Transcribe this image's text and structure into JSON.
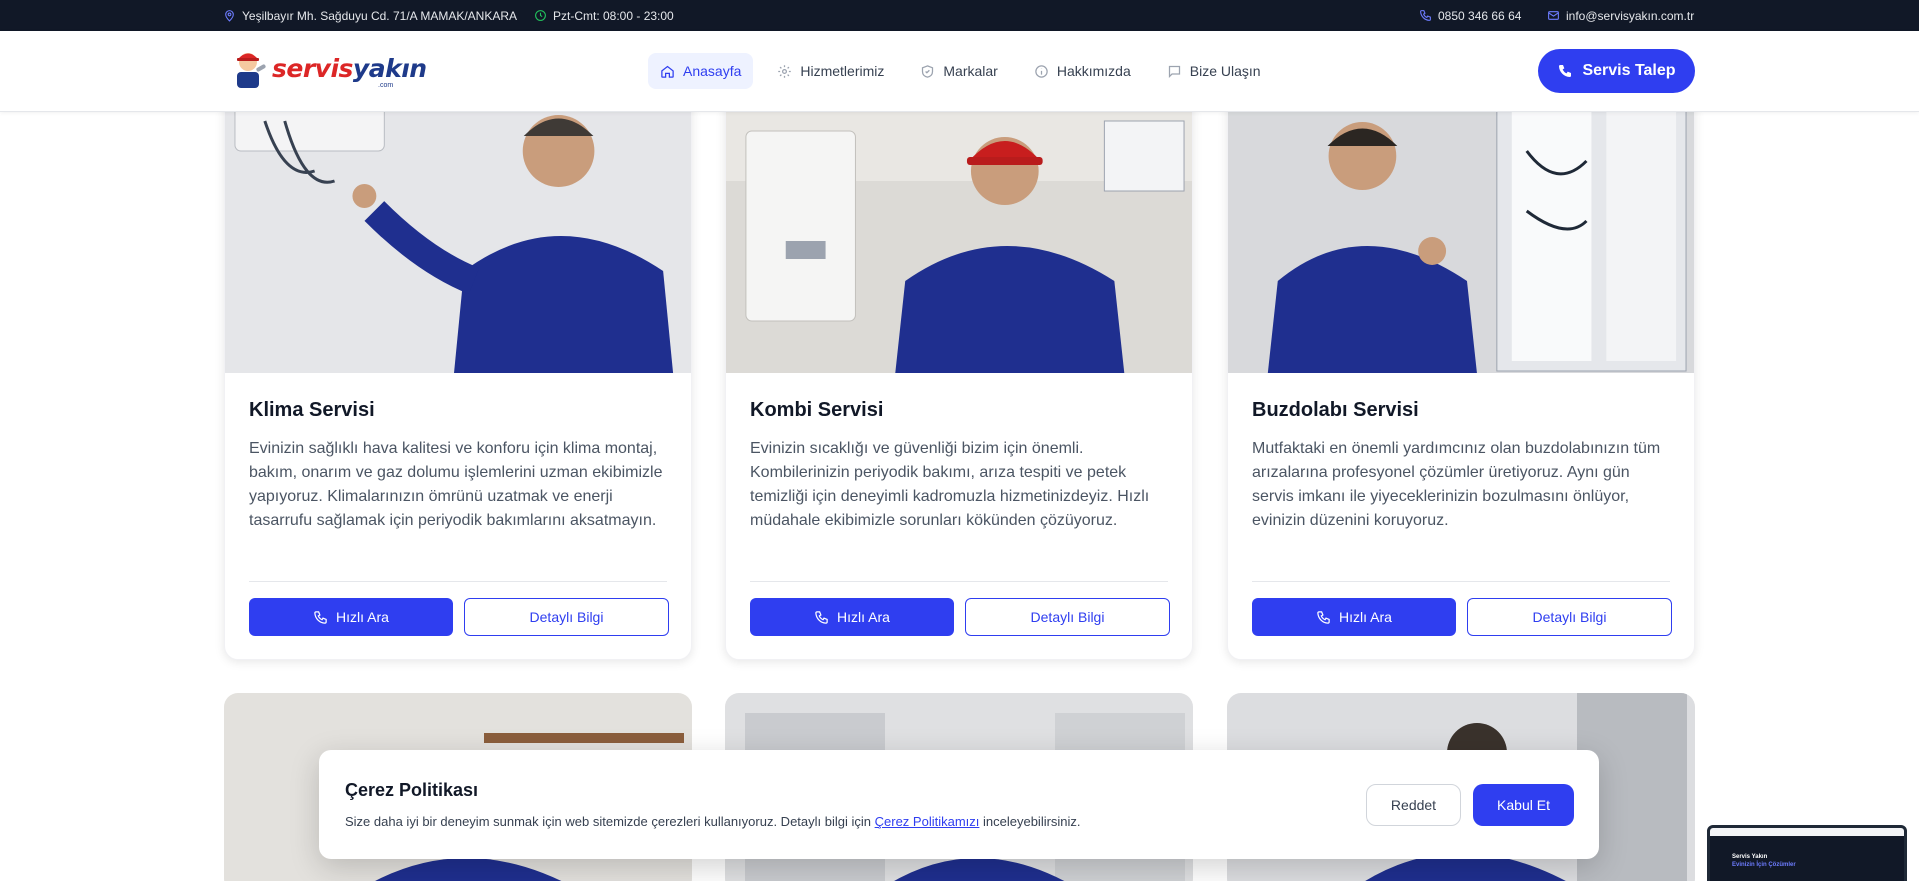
{
  "topbar": {
    "address": "Yeşilbayır Mh. Sağduyu Cd. 71/A MAMAK/ANKARA",
    "hours": "Pzt-Cmt: 08:00 - 23:00",
    "phone": "0850 346 66 64",
    "email": "info@servisyakın.com.tr"
  },
  "header": {
    "logo": {
      "part1": "servis",
      "part2": "yakın",
      "tld": ".com"
    },
    "nav": [
      {
        "label": "Anasayfa",
        "icon": "home-icon",
        "active": true
      },
      {
        "label": "Hizmetlerimiz",
        "icon": "gear-icon",
        "active": false
      },
      {
        "label": "Markalar",
        "icon": "shield-icon",
        "active": false
      },
      {
        "label": "Hakkımızda",
        "icon": "info-icon",
        "active": false
      },
      {
        "label": "Bize Ulaşın",
        "icon": "chat-icon",
        "active": false
      }
    ],
    "cta_label": "Servis Talep"
  },
  "services": [
    {
      "title": "Klima Servisi",
      "description": "Evinizin sağlıklı hava kalitesi ve konforu için klima montaj, bakım, onarım ve gaz dolumu işlemlerini uzman ekibimizle yapıyoruz. Klimalarınızın ömrünü uzatmak ve enerji tasarrufu sağlamak için periyodik bakımlarını aksatmayın.",
      "call_label": "Hızlı Ara",
      "info_label": "Detaylı Bilgi"
    },
    {
      "title": "Kombi Servisi",
      "description": "Evinizin sıcaklığı ve güvenliği bizim için önemli. Kombilerinizin periyodik bakımı, arıza tespiti ve petek temizliği için deneyimli kadromuzla hizmetinizdeyiz. Hızlı müdahale ekibimizle sorunları kökünden çözüyoruz.",
      "call_label": "Hızlı Ara",
      "info_label": "Detaylı Bilgi"
    },
    {
      "title": "Buzdolabı Servisi",
      "description": "Mutfaktaki en önemli yardımcınız olan buzdolabınızın tüm arızalarına profesyonel çözümler üretiyoruz. Aynı gün servis imkanı ile yiyeceklerinizin bozulmasını önlüyor, evinizin düzenini koruyoruz.",
      "call_label": "Hızlı Ara",
      "info_label": "Detaylı Bilgi"
    }
  ],
  "cookie": {
    "title": "Çerez Politikası",
    "text_before": "Size daha iyi bir deneyim sunmak için web sitemizde çerezleri kullanıyoruz. Detaylı bilgi için",
    "link_label": "Çerez Politikamızı",
    "text_after": "inceleyebilirsiniz.",
    "reject_label": "Reddet",
    "accept_label": "Kabul Et"
  },
  "preview": {
    "line1": "Servis Yakın",
    "line2": "Evinizin İçin Çözümler"
  },
  "colors": {
    "accent": "#2f3ef0",
    "topbar_bg": "#111827",
    "brand_red": "#dc2626",
    "brand_blue": "#1e3a8a"
  }
}
